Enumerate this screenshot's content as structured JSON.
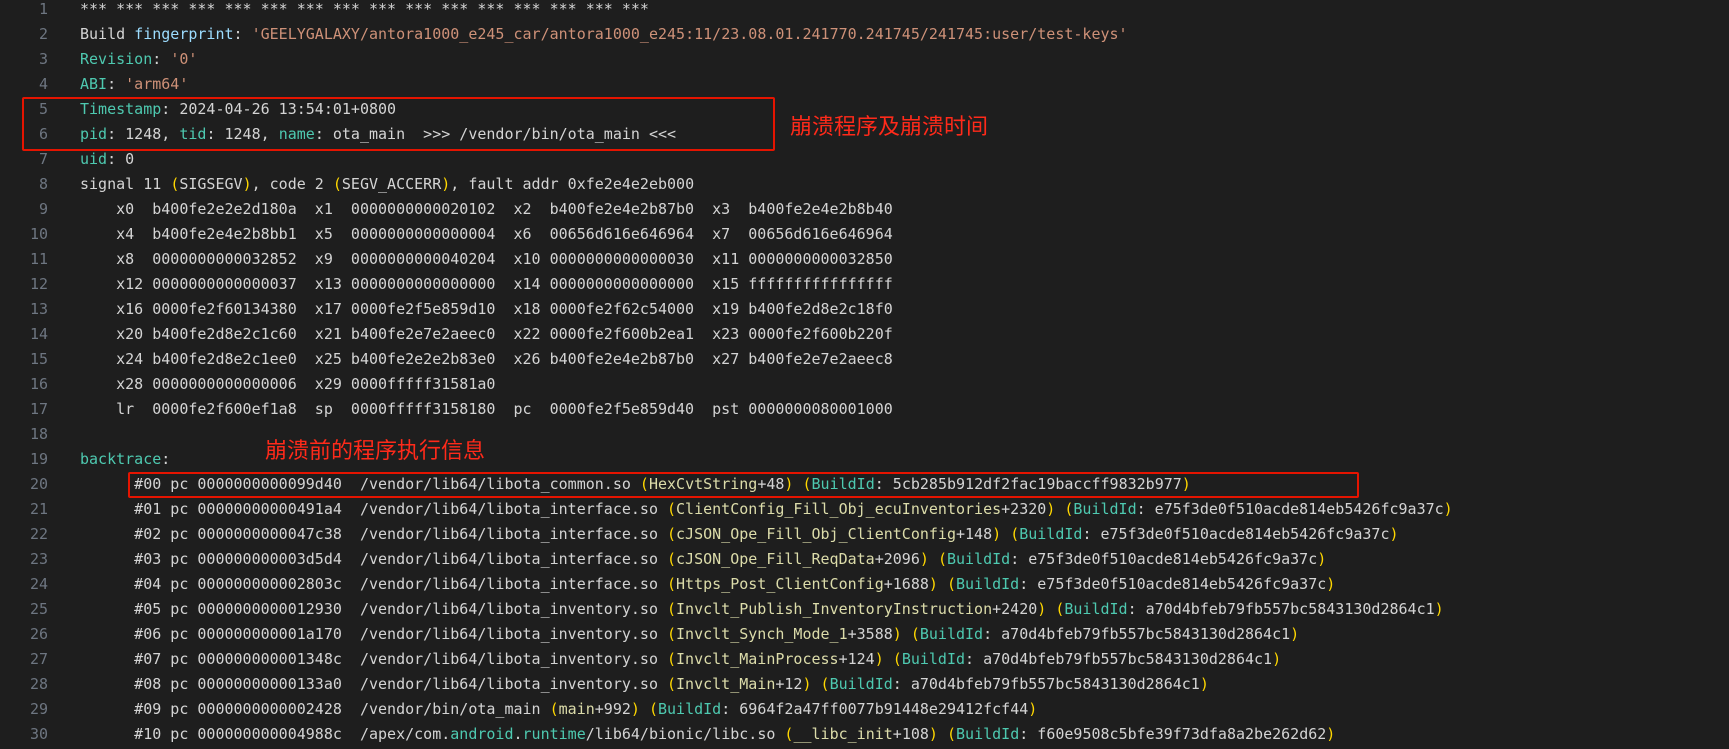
{
  "annotations": {
    "crash_info": "崩溃程序及崩溃时间",
    "backtrace_info": "崩溃前的程序执行信息"
  },
  "colors": {
    "background": "#1e1e1e",
    "line_number": "#6e7681",
    "highlight_box": "#e51400",
    "annotation_text": "#ff2a1a"
  },
  "lines": [
    {
      "n": "1",
      "segs": [
        [
          "plain",
          "*** *** *** *** *** *** *** *** *** *** *** *** *** *** *** ***"
        ]
      ]
    },
    {
      "n": "2",
      "segs": [
        [
          "plain",
          "Build "
        ],
        [
          "key",
          "fingerprint"
        ],
        [
          "plain",
          ": "
        ],
        [
          "str",
          "'GEELYGALAXY/antora1000_e245_car/antora1000_e245:11/23.08.01.241770.241745/241745:user/test-keys'"
        ]
      ]
    },
    {
      "n": "3",
      "segs": [
        [
          "teal",
          "Revision"
        ],
        [
          "plain",
          ": "
        ],
        [
          "str",
          "'0'"
        ]
      ]
    },
    {
      "n": "4",
      "segs": [
        [
          "teal",
          "ABI"
        ],
        [
          "plain",
          ": "
        ],
        [
          "str",
          "'arm64'"
        ]
      ]
    },
    {
      "n": "5",
      "segs": [
        [
          "teal",
          "Timestamp"
        ],
        [
          "plain",
          ": 2024-04-26 13:54:01+0800"
        ]
      ]
    },
    {
      "n": "6",
      "segs": [
        [
          "teal",
          "pid"
        ],
        [
          "plain",
          ": 1248, "
        ],
        [
          "teal",
          "tid"
        ],
        [
          "plain",
          ": 1248, "
        ],
        [
          "teal",
          "name"
        ],
        [
          "plain",
          ": ota_main  >>> /vendor/bin/ota_main <<<"
        ]
      ]
    },
    {
      "n": "7",
      "segs": [
        [
          "teal",
          "uid"
        ],
        [
          "plain",
          ": 0"
        ]
      ]
    },
    {
      "n": "8",
      "segs": [
        [
          "plain",
          "signal 11 "
        ],
        [
          "par",
          "("
        ],
        [
          "plain",
          "SIGSEGV"
        ],
        [
          "par",
          ")"
        ],
        [
          "plain",
          ", code 2 "
        ],
        [
          "par",
          "("
        ],
        [
          "plain",
          "SEGV_ACCERR"
        ],
        [
          "par",
          ")"
        ],
        [
          "plain",
          ", fault addr 0xfe2e4e2eb000"
        ]
      ]
    },
    {
      "n": "9",
      "segs": [
        [
          "plain",
          "    x0  b400fe2e2e2d180a  x1  0000000000020102  x2  b400fe2e4e2b87b0  x3  b400fe2e4e2b8b40"
        ]
      ]
    },
    {
      "n": "10",
      "segs": [
        [
          "plain",
          "    x4  b400fe2e4e2b8bb1  x5  0000000000000004  x6  00656d616e646964  x7  00656d616e646964"
        ]
      ]
    },
    {
      "n": "11",
      "segs": [
        [
          "plain",
          "    x8  0000000000032852  x9  0000000000040204  x10 0000000000000030  x11 0000000000032850"
        ]
      ]
    },
    {
      "n": "12",
      "segs": [
        [
          "plain",
          "    x12 0000000000000037  x13 0000000000000000  x14 0000000000000000  x15 ffffffffffffffff"
        ]
      ]
    },
    {
      "n": "13",
      "segs": [
        [
          "plain",
          "    x16 0000fe2f60134380  x17 0000fe2f5e859d10  x18 0000fe2f62c54000  x19 b400fe2d8e2c18f0"
        ]
      ]
    },
    {
      "n": "14",
      "segs": [
        [
          "plain",
          "    x20 b400fe2d8e2c1c60  x21 b400fe2e7e2aeec0  x22 0000fe2f600b2ea1  x23 0000fe2f600b220f"
        ]
      ]
    },
    {
      "n": "15",
      "segs": [
        [
          "plain",
          "    x24 b400fe2d8e2c1ee0  x25 b400fe2e2e2b83e0  x26 b400fe2e4e2b87b0  x27 b400fe2e7e2aeec8"
        ]
      ]
    },
    {
      "n": "16",
      "segs": [
        [
          "plain",
          "    x28 0000000000000006  x29 0000fffff31581a0"
        ]
      ]
    },
    {
      "n": "17",
      "segs": [
        [
          "plain",
          "    lr  0000fe2f600ef1a8  sp  0000fffff3158180  pc  0000fe2f5e859d40  pst 0000000080001000"
        ]
      ]
    },
    {
      "n": "18",
      "segs": [
        [
          "plain",
          ""
        ]
      ]
    },
    {
      "n": "19",
      "segs": [
        [
          "teal",
          "backtrace"
        ],
        [
          "plain",
          ":"
        ]
      ]
    },
    {
      "n": "20",
      "segs": [
        [
          "plain",
          "      #00 pc 0000000000099d40  /vendor/lib64/libota_common.so "
        ],
        [
          "par",
          "("
        ],
        [
          "yel",
          "HexCvtString"
        ],
        [
          "plain",
          "+48"
        ],
        [
          "par",
          ")"
        ],
        [
          "plain",
          " "
        ],
        [
          "par",
          "("
        ],
        [
          "teal",
          "BuildId"
        ],
        [
          "plain",
          ": 5cb285b912df2fac19baccff9832b977"
        ],
        [
          "par",
          ")"
        ]
      ]
    },
    {
      "n": "21",
      "segs": [
        [
          "plain",
          "      #01 pc 00000000000491a4  /vendor/lib64/libota_interface.so "
        ],
        [
          "par",
          "("
        ],
        [
          "yel",
          "ClientConfig_Fill_Obj_ecuInventories"
        ],
        [
          "plain",
          "+2320"
        ],
        [
          "par",
          ")"
        ],
        [
          "plain",
          " "
        ],
        [
          "par",
          "("
        ],
        [
          "teal",
          "BuildId"
        ],
        [
          "plain",
          ": e75f3de0f510acde814eb5426fc9a37c"
        ],
        [
          "par",
          ")"
        ]
      ]
    },
    {
      "n": "22",
      "segs": [
        [
          "plain",
          "      #02 pc 0000000000047c38  /vendor/lib64/libota_interface.so "
        ],
        [
          "par",
          "("
        ],
        [
          "yel",
          "cJSON_Ope_Fill_Obj_ClientConfig"
        ],
        [
          "plain",
          "+148"
        ],
        [
          "par",
          ")"
        ],
        [
          "plain",
          " "
        ],
        [
          "par",
          "("
        ],
        [
          "teal",
          "BuildId"
        ],
        [
          "plain",
          ": e75f3de0f510acde814eb5426fc9a37c"
        ],
        [
          "par",
          ")"
        ]
      ]
    },
    {
      "n": "23",
      "segs": [
        [
          "plain",
          "      #03 pc 000000000003d5d4  /vendor/lib64/libota_interface.so "
        ],
        [
          "par",
          "("
        ],
        [
          "yel",
          "cJSON_Ope_Fill_ReqData"
        ],
        [
          "plain",
          "+2096"
        ],
        [
          "par",
          ")"
        ],
        [
          "plain",
          " "
        ],
        [
          "par",
          "("
        ],
        [
          "teal",
          "BuildId"
        ],
        [
          "plain",
          ": e75f3de0f510acde814eb5426fc9a37c"
        ],
        [
          "par",
          ")"
        ]
      ]
    },
    {
      "n": "24",
      "segs": [
        [
          "plain",
          "      #04 pc 000000000002803c  /vendor/lib64/libota_interface.so "
        ],
        [
          "par",
          "("
        ],
        [
          "yel",
          "Https_Post_ClientConfig"
        ],
        [
          "plain",
          "+1688"
        ],
        [
          "par",
          ")"
        ],
        [
          "plain",
          " "
        ],
        [
          "par",
          "("
        ],
        [
          "teal",
          "BuildId"
        ],
        [
          "plain",
          ": e75f3de0f510acde814eb5426fc9a37c"
        ],
        [
          "par",
          ")"
        ]
      ]
    },
    {
      "n": "25",
      "segs": [
        [
          "plain",
          "      #05 pc 0000000000012930  /vendor/lib64/libota_inventory.so "
        ],
        [
          "par",
          "("
        ],
        [
          "yel",
          "Invclt_Publish_InventoryInstruction"
        ],
        [
          "plain",
          "+2420"
        ],
        [
          "par",
          ")"
        ],
        [
          "plain",
          " "
        ],
        [
          "par",
          "("
        ],
        [
          "teal",
          "BuildId"
        ],
        [
          "plain",
          ": a70d4bfeb79fb557bc5843130d2864c1"
        ],
        [
          "par",
          ")"
        ]
      ]
    },
    {
      "n": "26",
      "segs": [
        [
          "plain",
          "      #06 pc 000000000001a170  /vendor/lib64/libota_inventory.so "
        ],
        [
          "par",
          "("
        ],
        [
          "yel",
          "Invclt_Synch_Mode_1"
        ],
        [
          "plain",
          "+3588"
        ],
        [
          "par",
          ")"
        ],
        [
          "plain",
          " "
        ],
        [
          "par",
          "("
        ],
        [
          "teal",
          "BuildId"
        ],
        [
          "plain",
          ": a70d4bfeb79fb557bc5843130d2864c1"
        ],
        [
          "par",
          ")"
        ]
      ]
    },
    {
      "n": "27",
      "segs": [
        [
          "plain",
          "      #07 pc 000000000001348c  /vendor/lib64/libota_inventory.so "
        ],
        [
          "par",
          "("
        ],
        [
          "yel",
          "Invclt_MainProcess"
        ],
        [
          "plain",
          "+124"
        ],
        [
          "par",
          ")"
        ],
        [
          "plain",
          " "
        ],
        [
          "par",
          "("
        ],
        [
          "teal",
          "BuildId"
        ],
        [
          "plain",
          ": a70d4bfeb79fb557bc5843130d2864c1"
        ],
        [
          "par",
          ")"
        ]
      ]
    },
    {
      "n": "28",
      "segs": [
        [
          "plain",
          "      #08 pc 00000000000133a0  /vendor/lib64/libota_inventory.so "
        ],
        [
          "par",
          "("
        ],
        [
          "yel",
          "Invclt_Main"
        ],
        [
          "plain",
          "+12"
        ],
        [
          "par",
          ")"
        ],
        [
          "plain",
          " "
        ],
        [
          "par",
          "("
        ],
        [
          "teal",
          "BuildId"
        ],
        [
          "plain",
          ": a70d4bfeb79fb557bc5843130d2864c1"
        ],
        [
          "par",
          ")"
        ]
      ]
    },
    {
      "n": "29",
      "segs": [
        [
          "plain",
          "      #09 pc 0000000000002428  /vendor/bin/ota_main "
        ],
        [
          "par",
          "("
        ],
        [
          "yel",
          "main"
        ],
        [
          "plain",
          "+992"
        ],
        [
          "par",
          ")"
        ],
        [
          "plain",
          " "
        ],
        [
          "par",
          "("
        ],
        [
          "teal",
          "BuildId"
        ],
        [
          "plain",
          ": 6964f2a47ff0077b91448e29412fcf44"
        ],
        [
          "par",
          ")"
        ]
      ]
    },
    {
      "n": "30",
      "segs": [
        [
          "plain",
          "      #10 pc 000000000004988c  /apex/com."
        ],
        [
          "teal",
          "android"
        ],
        [
          "plain",
          "."
        ],
        [
          "teal",
          "runtime"
        ],
        [
          "plain",
          "/lib64/bionic/libc.so "
        ],
        [
          "par",
          "("
        ],
        [
          "yel",
          "__libc_init"
        ],
        [
          "plain",
          "+108"
        ],
        [
          "par",
          ")"
        ],
        [
          "plain",
          " "
        ],
        [
          "par",
          "("
        ],
        [
          "teal",
          "BuildId"
        ],
        [
          "plain",
          ": f60e9508c5bfe39f73dfa8a2be262d62"
        ],
        [
          "par",
          ")"
        ]
      ]
    }
  ]
}
